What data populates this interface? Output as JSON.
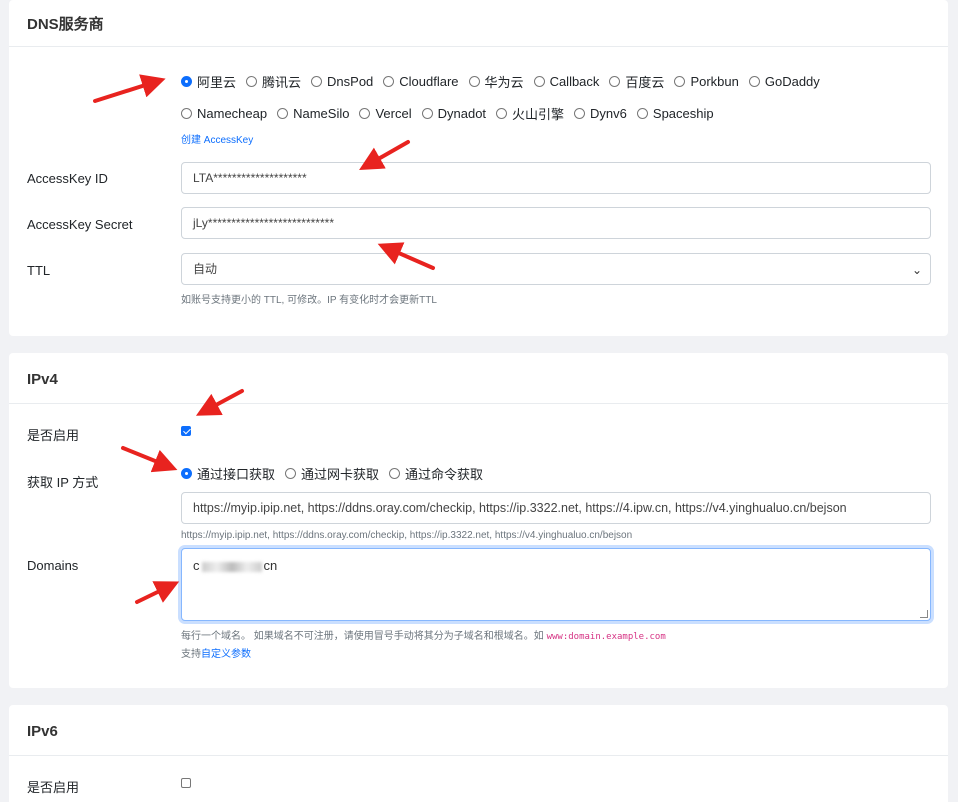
{
  "dns": {
    "title": "DNS服务商",
    "providers_row1": [
      "阿里云",
      "腾讯云",
      "DnsPod",
      "Cloudflare",
      "华为云",
      "Callback",
      "百度云",
      "Porkbun",
      "GoDaddy"
    ],
    "providers_row2": [
      "Namecheap",
      "NameSilo",
      "Vercel",
      "Dynadot",
      "火山引擎",
      "Dynv6",
      "Spaceship"
    ],
    "selected": "阿里云",
    "create_link": "创建 AccessKey",
    "access_key_id_label": "AccessKey ID",
    "access_key_id_value": "LTA********************",
    "access_key_secret_label": "AccessKey Secret",
    "access_key_secret_value": "jLy***************************",
    "ttl_label": "TTL",
    "ttl_value": "自动",
    "ttl_help": "如账号支持更小的 TTL, 可修改。IP 有变化时才会更新TTL"
  },
  "ipv4": {
    "title": "IPv4",
    "enabled_label": "是否启用",
    "enabled": true,
    "method_label": "获取 IP 方式",
    "methods": [
      "通过接口获取",
      "通过网卡获取",
      "通过命令获取"
    ],
    "selected_method": "通过接口获取",
    "url_value": "https://myip.ipip.net, https://ddns.oray.com/checkip, https://ip.3322.net, https://4.ipw.cn, https://v4.yinghualuo.cn/bejson",
    "url_help": "https://myip.ipip.net, https://ddns.oray.com/checkip, https://ip.3322.net, https://v4.yinghualuo.cn/bejson",
    "domains_label": "Domains",
    "domains_prefix": "c",
    "domains_suffix": "cn",
    "domains_help": "每行一个域名。 如果域名不可注册，请使用冒号手动将其分为子域名和根域名。如",
    "domains_help_code": "www:domain.example.com",
    "custom_params_prefix": "支持",
    "custom_params_link": "自定义参数"
  },
  "ipv6": {
    "title": "IPv6",
    "enabled_label": "是否启用",
    "enabled": false
  },
  "colors": {
    "accent": "#0d6efd",
    "arrow": "#e8231f"
  }
}
